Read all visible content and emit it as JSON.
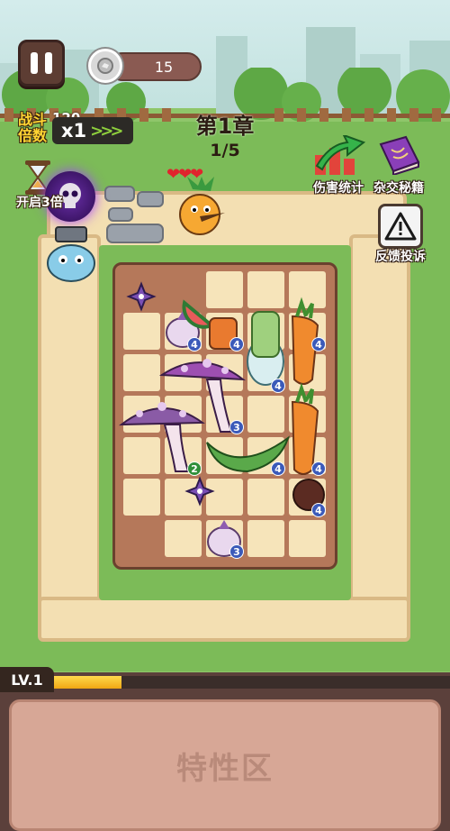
{
  "hud": {
    "coins": "15",
    "speed_label": "战斗倍数",
    "speed_bg_num": "120",
    "speed_value": "x1",
    "chapter": "第1章",
    "wave": "1/5",
    "triple_label": "开启3倍",
    "damage_stats": "伤害统计",
    "hybrid_book": "杂交秘籍",
    "feedback": "反馈投诉",
    "hearts": 3
  },
  "board_badges": [
    {
      "value": "4",
      "kind": "blue"
    },
    {
      "value": "4",
      "kind": "blue"
    },
    {
      "value": "4",
      "kind": "blue"
    },
    {
      "value": "4",
      "kind": "blue"
    },
    {
      "value": "3",
      "kind": "blue"
    },
    {
      "value": "2",
      "kind": "green"
    },
    {
      "value": "4",
      "kind": "blue"
    },
    {
      "value": "4",
      "kind": "blue"
    },
    {
      "value": "4",
      "kind": "blue"
    },
    {
      "value": "3",
      "kind": "blue"
    }
  ],
  "level": {
    "label": "LV.1",
    "progress": 0.18
  },
  "trait_area_label": "特性区",
  "colors": {
    "gold_text": "#ffd533",
    "xp_fill": "#f0a713",
    "board": "#b5785a",
    "cell": "#f6e4ba"
  }
}
